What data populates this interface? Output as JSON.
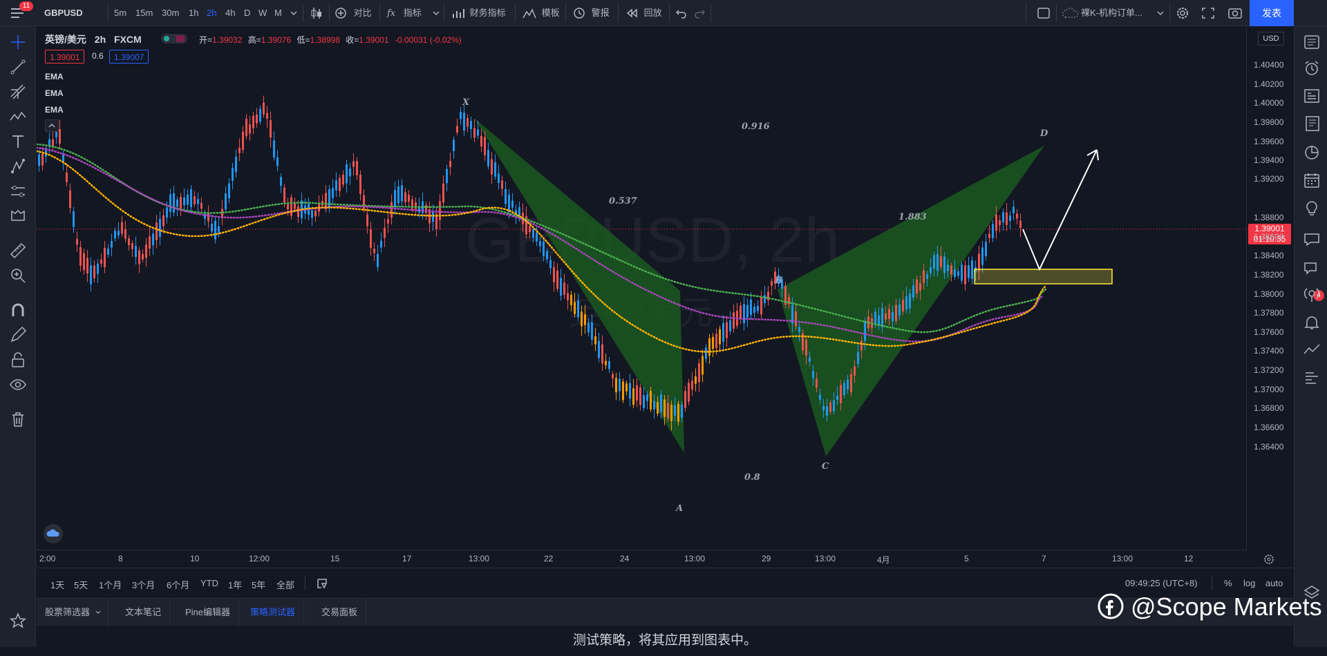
{
  "topbar": {
    "notification_count": "11",
    "symbol": "GBPUSD",
    "intervals": [
      "5m",
      "15m",
      "30m",
      "1h",
      "2h",
      "4h",
      "D",
      "W",
      "M"
    ],
    "active_interval": "2h",
    "compare_label": "对比",
    "indicators_label": "指标",
    "financials_label": "财务指标",
    "templates_label": "模板",
    "alert_label": "警报",
    "replay_label": "回放",
    "layout_name": "裸K-机构订单...",
    "publish_label": "发表"
  },
  "legend": {
    "title": "英镑/美元",
    "interval": "2h",
    "source": "FXCM",
    "open_label": "开=",
    "open": "1.39032",
    "high_label": "高=",
    "high": "1.39076",
    "low_label": "低=",
    "low": "1.38998",
    "close_label": "收=",
    "close": "1.39001",
    "change": "-0.00031 (-0.02%)",
    "bid": "1.39001",
    "spread": "0.6",
    "ask": "1.39007",
    "indicators": [
      "EMA",
      "EMA",
      "EMA"
    ]
  },
  "chart": {
    "watermark_symbol": "GBPUSD, 2h",
    "watermark_name": "英镑/美元",
    "currency": "USD",
    "last_price": "1.39001",
    "countdown": "01:10:35",
    "price_ticks": [
      "1.40400",
      "1.40200",
      "1.40000",
      "1.39800",
      "1.39600",
      "1.39400",
      "1.39200",
      "1.38800",
      "1.38600",
      "1.38400",
      "1.38200",
      "1.38000",
      "1.37800",
      "1.37600",
      "1.37400",
      "1.37200",
      "1.37000",
      "1.36800",
      "1.36600",
      "1.36400"
    ],
    "time_ticks": [
      "2:00",
      "8",
      "10",
      "12:00",
      "15",
      "17",
      "13:00",
      "22",
      "24",
      "13:00",
      "29",
      "13:00",
      "4月",
      "5",
      "7",
      "13:00",
      "12"
    ],
    "pattern_points": [
      "X",
      "A",
      "B",
      "C",
      "D"
    ],
    "pattern_ratios": [
      "0.916",
      "0.537",
      "0.8",
      "1.883"
    ],
    "colors": {
      "up": "#2196f3",
      "down": "#ef5350",
      "pattern": "#1b5e20",
      "zone": "#ffeb3b"
    }
  },
  "rangebar": {
    "ranges": [
      "1天",
      "5天",
      "1个月",
      "3个月",
      "6个月",
      "YTD",
      "1年",
      "5年",
      "全部"
    ],
    "clock": "09:49:25 (UTC+8)",
    "percent_label": "%",
    "log_label": "log",
    "auto_label": "auto"
  },
  "bottom_tabs": {
    "tabs": [
      "股票筛选器",
      "文本笔记",
      "Pine编辑器",
      "策略测试器",
      "交易面板"
    ],
    "active": "策略测试器",
    "message": "测试策略，将其应用到图表中。"
  },
  "right_badge": "4",
  "brand_watermark": "@Scope Markets"
}
